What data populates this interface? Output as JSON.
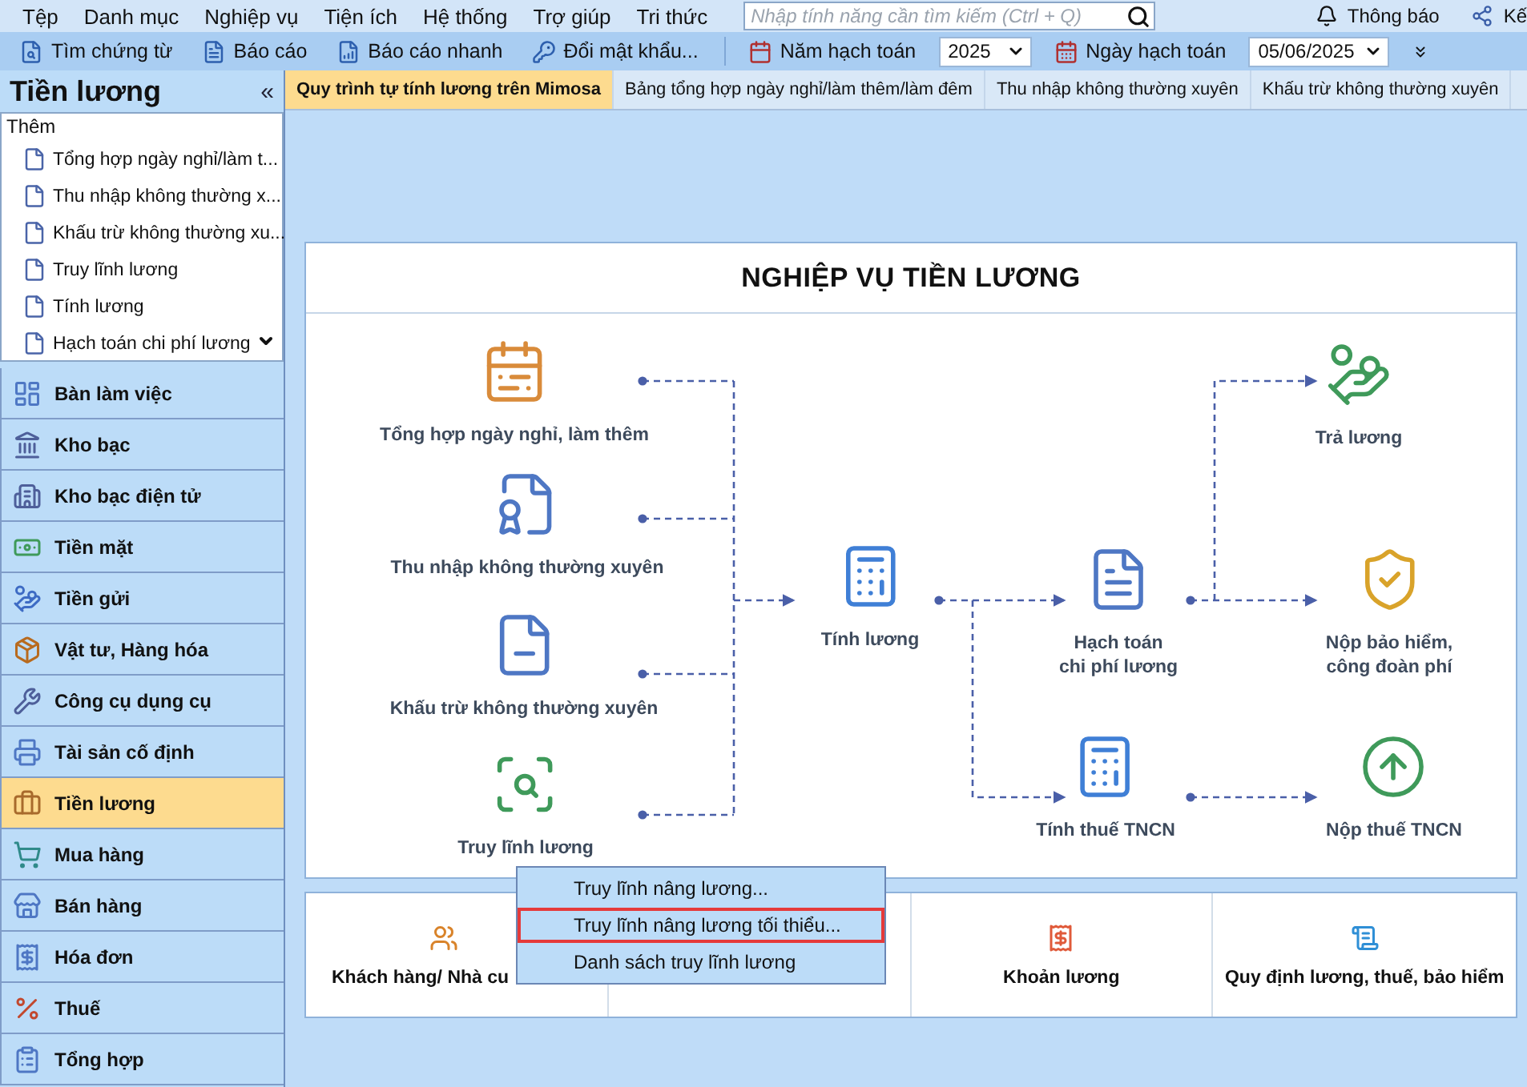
{
  "menu_bar": {
    "items": [
      "Tệp",
      "Danh mục",
      "Nghiệp vụ",
      "Tiện ích",
      "Hệ thống",
      "Trợ giúp",
      "Tri thức"
    ],
    "search": {
      "placeholder": "Nhập tính năng cần tìm kiếm (Ctrl + Q)"
    },
    "notification": "Thông báo",
    "connect": "Kế"
  },
  "toolbar": {
    "buttons": [
      "Tìm chứng từ",
      "Báo cáo",
      "Báo cáo nhanh",
      "Đổi mật khẩu..."
    ],
    "fiscal_year": {
      "label": "Năm hạch toán",
      "value": "2025"
    },
    "posting_date": {
      "label": "Ngày hạch toán",
      "value": "05/06/2025"
    }
  },
  "sidebar": {
    "title": "Tiền lương",
    "collapse": "«",
    "section": "Thêm",
    "shortcuts": [
      "Tổng hợp ngày nghỉ/làm t...",
      "Thu nhập không thường x...",
      "Khấu trừ không thường xu...",
      "Truy lĩnh lương",
      "Tính lương",
      "Hạch toán chi phí lương"
    ],
    "modules": [
      {
        "label": "Bàn làm việc",
        "selected": false
      },
      {
        "label": "Kho bạc",
        "selected": false
      },
      {
        "label": "Kho bạc điện tử",
        "selected": false
      },
      {
        "label": "Tiền mặt",
        "selected": false
      },
      {
        "label": "Tiền gửi",
        "selected": false
      },
      {
        "label": "Vật tư, Hàng hóa",
        "selected": false
      },
      {
        "label": "Công cụ dụng cụ",
        "selected": false
      },
      {
        "label": "Tài sản cố định",
        "selected": false
      },
      {
        "label": "Tiền lương",
        "selected": true
      },
      {
        "label": "Mua hàng",
        "selected": false
      },
      {
        "label": "Bán hàng",
        "selected": false
      },
      {
        "label": "Hóa đơn",
        "selected": false
      },
      {
        "label": "Thuế",
        "selected": false
      },
      {
        "label": "Tổng hợp",
        "selected": false
      }
    ]
  },
  "tabs": [
    {
      "label": "Quy trình tự tính lương trên Mimosa",
      "selected": true
    },
    {
      "label": "Bảng tổng hợp ngày nghỉ/làm thêm/làm đêm",
      "selected": false
    },
    {
      "label": "Thu nhập không thường xuyên",
      "selected": false
    },
    {
      "label": "Khấu trừ không thường xuyên",
      "selected": false
    }
  ],
  "diagram": {
    "title": "NGHIỆP VỤ TIỀN LƯƠNG",
    "nodes": [
      "Tổng hợp ngày nghỉ, làm thêm",
      "Thu nhập không thường xuyên",
      "Khấu trừ không thường xuyên",
      "Truy lĩnh lương",
      "Tính lương",
      "Hạch toán\nchi phí lương",
      "Tính thuế TNCN",
      "Trả lương",
      "Nộp bảo hiểm,\ncông đoàn phí",
      "Nộp thuế TNCN"
    ]
  },
  "quick_links": [
    "Khách hàng/ Nhà cu",
    "Khoản lương",
    "Quy định lương, thuế, bảo hiểm"
  ],
  "context_menu": {
    "items": [
      {
        "label": "Truy lĩnh nâng lương...",
        "selected": false
      },
      {
        "label": "Truy lĩnh nâng lương tối thiểu...",
        "selected": true
      },
      {
        "label": "Danh sách truy lĩnh lương",
        "selected": false
      }
    ]
  }
}
